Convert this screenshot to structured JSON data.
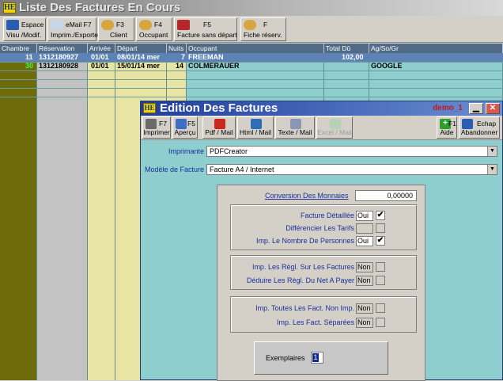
{
  "main": {
    "title": "Liste Des Factures En Cours",
    "toolbar": [
      {
        "key": "Espace",
        "label": "Visu /Modif."
      },
      {
        "key": "eMail  F7",
        "label": "Imprim./Exporte"
      },
      {
        "key": "F3",
        "label": "Client"
      },
      {
        "key": "F4",
        "label": "Occupant"
      },
      {
        "key": "F5",
        "label": "Facture sans départ"
      },
      {
        "key": "F",
        "label": "Fiche réserv."
      }
    ],
    "columns": [
      "Chambre",
      "Réservation",
      "Arrivée",
      "Départ",
      "Nuits",
      "Occupant",
      "Total Dû",
      "Ag/So/Gr"
    ],
    "rows": [
      {
        "chambre": "11",
        "reservation": "1312180927",
        "arrivee": "01/01",
        "depart": "08/01/14 mer",
        "nuits": "7",
        "occupant": "FREEMAN",
        "total": "102,00",
        "agsogr": ""
      },
      {
        "chambre": "30",
        "reservation": "1312180928",
        "arrivee": "01/01",
        "depart": "15/01/14 mer",
        "nuits": "14",
        "occupant": "COLMERAUER",
        "total": "",
        "agsogr": "GOOGLE"
      }
    ]
  },
  "dialog": {
    "title": "Edition Des Factures",
    "user": "demo_1",
    "toolbar": {
      "imprimer": {
        "key": "F7",
        "label": "Imprimer"
      },
      "apercu": {
        "key": "F5",
        "label": "Aperçu"
      },
      "pdf": {
        "label": "Pdf / Mail"
      },
      "html": {
        "label": "Html / Mail"
      },
      "texte": {
        "label": "Texte / Mail"
      },
      "excel": {
        "label": "Excel / Mail"
      },
      "aide": {
        "key": "F1",
        "label": "Aide"
      },
      "abandonner": {
        "key": "Echap",
        "label": "Abandonner"
      }
    },
    "imprimante": {
      "label": "Imprimante",
      "value": "PDFCreator"
    },
    "modele": {
      "label": "Modèle de Facture",
      "value": "Facture A4 / Internet"
    },
    "conversion": {
      "label": "Conversion Des Monnaies",
      "value": "0,00000"
    },
    "options1": [
      {
        "label": "Facture Détaillée",
        "value": "Oui",
        "checked": true,
        "enabled": true
      },
      {
        "label": "Différencier Les Tarifs",
        "value": "",
        "checked": false,
        "enabled": false
      },
      {
        "label": "Imp. Le Nombre De Personnes",
        "value": "Oui",
        "checked": true,
        "enabled": true
      }
    ],
    "options2": [
      {
        "label": "Imp. Les Règl. Sur Les Factures",
        "value": "Non",
        "checked": false,
        "enabled": false
      },
      {
        "label": "Déduire Les Règl. Du Net A Payer",
        "value": "Non",
        "checked": false,
        "enabled": false
      }
    ],
    "options3": [
      {
        "label": "Imp. Toutes Les Fact. Non Imp.",
        "value": "Non",
        "checked": false,
        "enabled": false
      },
      {
        "label": "Imp. Les Fact. Séparées",
        "value": "Non",
        "checked": false,
        "enabled": false
      }
    ],
    "exemplaires": {
      "label": "Exemplaires",
      "value": "1"
    }
  },
  "colors": {
    "grid_bg": "#8ecece",
    "header_bg": "#516b86",
    "selected_row": "#5d82b6",
    "label_blue": "#1a2f9a",
    "title_bar": "#1f3e9c",
    "user_red": "#c8141e"
  }
}
